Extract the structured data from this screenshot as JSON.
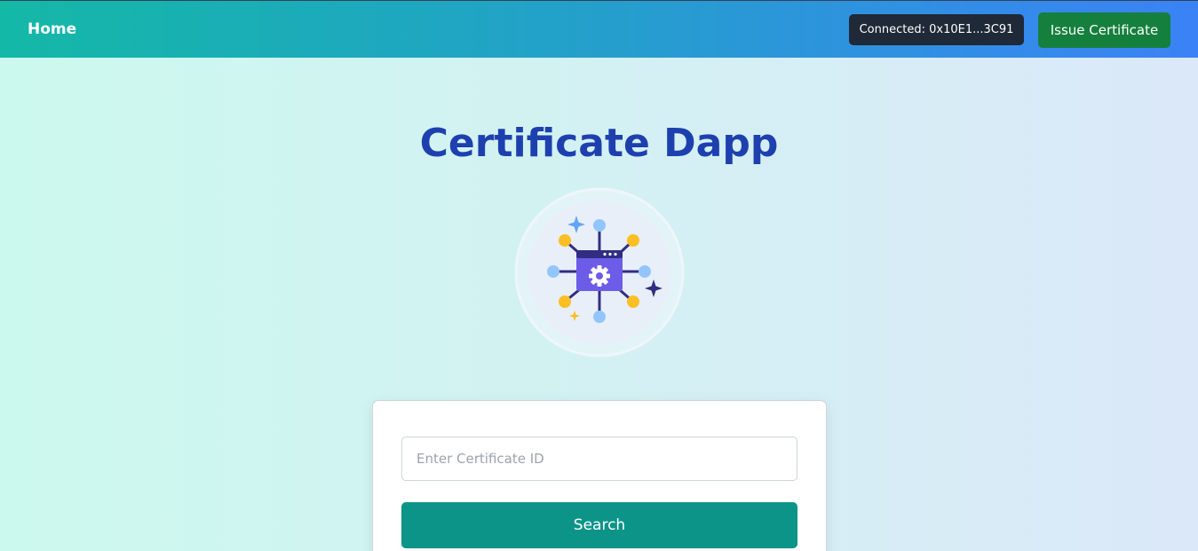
{
  "nav": {
    "home_label": "Home",
    "connected_label": "Connected: 0x10E1...3C91",
    "issue_label": "Issue Certificate"
  },
  "hero": {
    "title": "Certificate Dapp",
    "icon": "network-gear-icon"
  },
  "search": {
    "placeholder": "Enter Certificate ID",
    "value": "",
    "button_label": "Search"
  },
  "colors": {
    "nav_gradient_start": "#14b8a6",
    "nav_gradient_end": "#3b82f6",
    "title": "#1e40af",
    "issue_button": "#15803d",
    "search_button": "#0d9488",
    "badge": "#1f2937"
  }
}
